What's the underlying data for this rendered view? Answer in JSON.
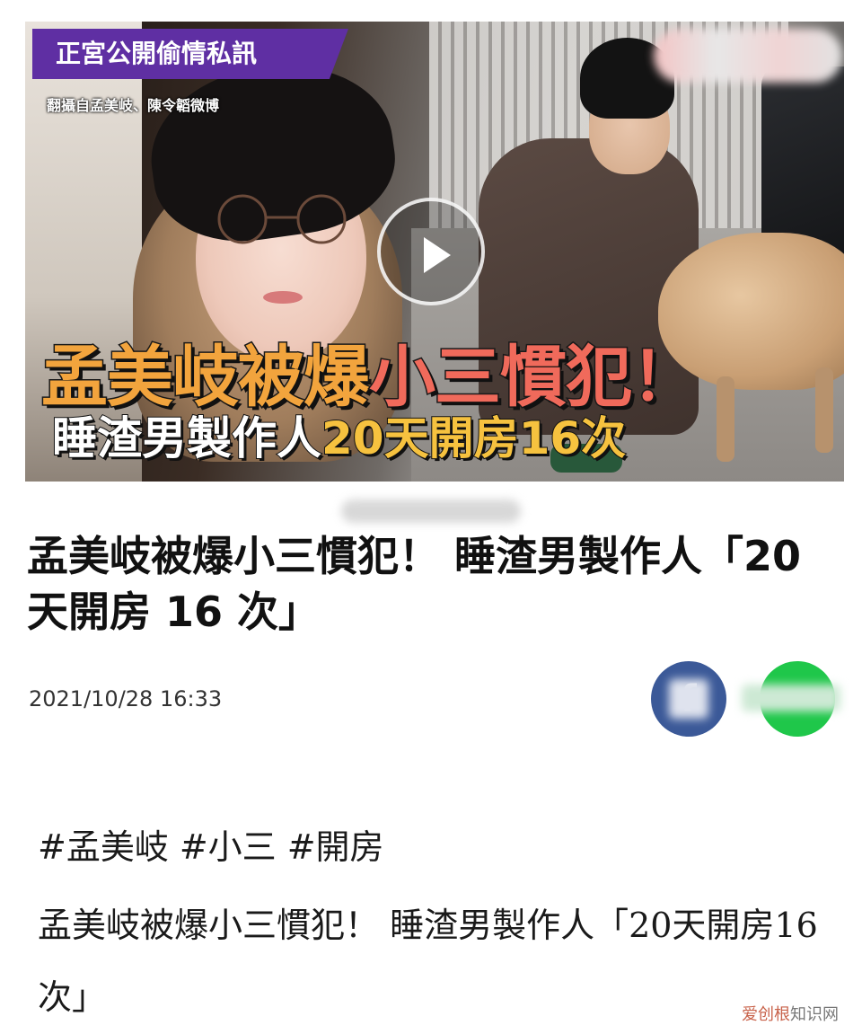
{
  "thumbnail": {
    "tag_banner": "正宮公開偷情私訊",
    "source_credit": "翻攝自孟美岐、陳令韜微博",
    "headline_main_a": "孟美岐被爆",
    "headline_main_b": "小三慣犯！",
    "headline_sub_a": "睡渣男製作人",
    "headline_sub_b": "20天開房16次",
    "colors": {
      "banner": "#5f2fa3",
      "headline_orange": "#f2a43d",
      "headline_red": "#f06a5b",
      "headline_yellow": "#f6c23f"
    },
    "play_icon": "play-icon"
  },
  "article": {
    "title": "孟美岐被爆小三慣犯！ 睡渣男製作人「20 天開房 16 次」",
    "date": "2021/10/28 16:33",
    "share": {
      "facebook_icon": "facebook-icon",
      "line_icon": "line-icon",
      "facebook_color": "#3b5998",
      "line_color": "#1fc74a"
    }
  },
  "post": {
    "hashtags": [
      "#孟美岐",
      "#小三",
      "#開房"
    ],
    "caption": "孟美岐被爆小三慣犯！ 睡渣男製作人「20天開房16次」"
  },
  "watermark": {
    "brand": "爱创根",
    "site": "知识网"
  }
}
